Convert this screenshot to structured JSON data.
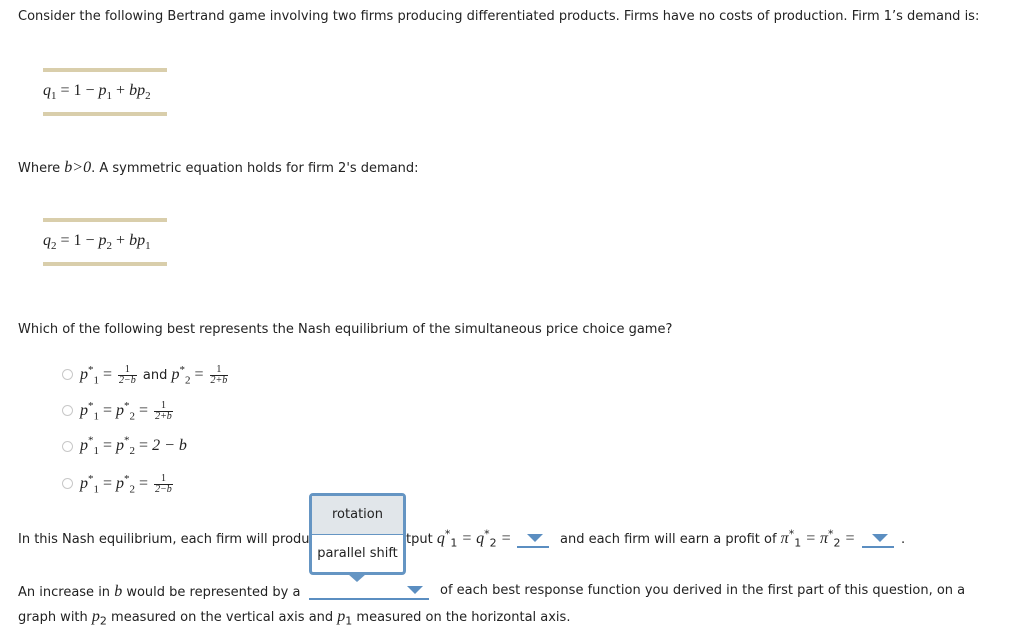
{
  "intro": {
    "text": "Consider the following Bertrand game involving two firms producing differentiated products. Firms have no costs of production. Firm 1’s demand is:"
  },
  "equation1": {
    "lhs_var": "q",
    "lhs_sub": "1",
    "rhs_prefix": " = 1 − ",
    "term1_var": "p",
    "term1_sub": "1",
    "plus": " + ",
    "term2_var": "bp",
    "term2_sub": "2"
  },
  "condition": {
    "prefix": "Where ",
    "math": "b>0",
    "suffix": ". A symmetric equation holds for firm 2's demand:"
  },
  "equation2": {
    "lhs_var": "q",
    "lhs_sub": "2",
    "rhs_prefix": " = 1 − ",
    "term1_var": "p",
    "term1_sub": "2",
    "plus": " + ",
    "term2_var": "bp",
    "term2_sub": "1"
  },
  "question": {
    "text": "Which of the following best represents the Nash equilibrium of the simultaneous price choice game?"
  },
  "options": [
    {
      "p": "p",
      "star": "*",
      "sub1": "1",
      "sub2": "2",
      "eq": " = ",
      "num1": "1",
      "den1": "2−b",
      "and": " and ",
      "num2": "1",
      "den2": "2+b"
    },
    {
      "p": "p",
      "star": "*",
      "sub1": "1",
      "sub2": "2",
      "eq": " = ",
      "num": "1",
      "den": "2+b"
    },
    {
      "p": "p",
      "star": "*",
      "sub1": "1",
      "sub2": "2",
      "eq": " = ",
      "rhs": "2 − b"
    },
    {
      "p": "p",
      "star": "*",
      "sub1": "1",
      "sub2": "2",
      "eq": " = ",
      "num": "1",
      "den": "2−b"
    }
  ],
  "equilibrium_sentence": {
    "part1": "In this Nash equilibrium, each firm will produ",
    "part1_hidden_tail": "ce an output",
    "part2": "tput ",
    "q_var": "q",
    "star": "*",
    "sub1": "1",
    "sub2": "2",
    "eq": " = ",
    "part3": "and each firm will earn a profit of ",
    "pi_var": "π",
    "period": "."
  },
  "dropdowns": {
    "output": {
      "selected": ""
    },
    "profit": {
      "selected": ""
    },
    "shift_type": {
      "selected": "",
      "options": [
        "rotation",
        "parallel shift"
      ],
      "highlighted": "rotation"
    }
  },
  "increase_sentence": {
    "prefix": "An increase in ",
    "b": "b",
    "middle": " would be represented by a",
    "suffix": "of each best response function you derived in the first part of this question, on a",
    "line2_prefix": "graph with ",
    "p_var": "p",
    "sub2": "2",
    "line2_mid": " measured on the vertical axis and ",
    "sub1": "1",
    "line2_end": " measured on the horizontal axis."
  },
  "colors": {
    "accent": "#5b8ec1",
    "popup_border": "#6595c3",
    "equation_bar": "#d9ceab",
    "popup_highlight": "#e1e6ea"
  }
}
